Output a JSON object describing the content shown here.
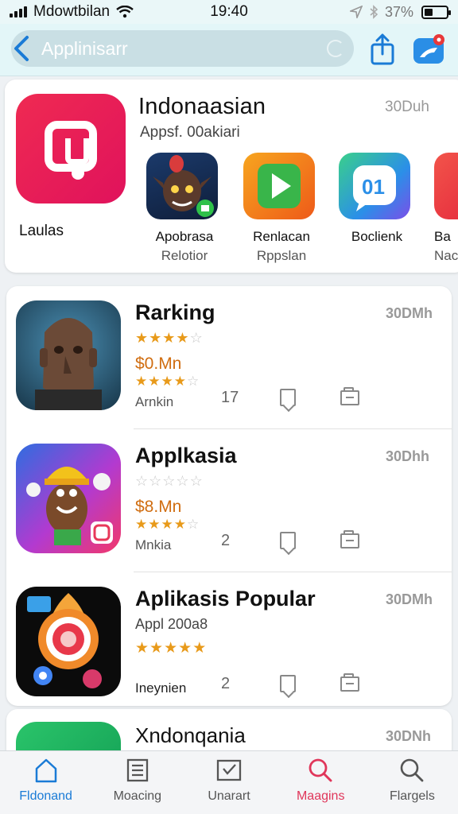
{
  "status": {
    "carrier": "Mdowtbilan",
    "time": "19:40",
    "battery": "37%",
    "battery_level": 0.37
  },
  "navbar": {
    "search_text": "Applinisarr"
  },
  "featured": {
    "title": "Indonaasian",
    "subtitle": "Appsf. 00akiari",
    "size": "30Duh",
    "label": "Laulas",
    "apps": [
      {
        "name": "Apobrasa",
        "sub": "Relotior"
      },
      {
        "name": "Renlacan",
        "sub": "Rppslan"
      },
      {
        "name": "Boclienk",
        "sub": ""
      },
      {
        "name": "Ba",
        "sub": "Nac"
      }
    ],
    "colors": {
      "main_icon": "#e81a58",
      "app2": "#f06a1a",
      "app3": "#2fa8e0"
    }
  },
  "list": [
    {
      "title": "Rarking",
      "size": "30DMh",
      "rating1": 4,
      "price": "$0.Mn",
      "rating2": 4,
      "meta": "Arnkin",
      "act1": "17"
    },
    {
      "title": "Applkasia",
      "size": "30Dhh",
      "rating1": 0,
      "price": "$8.Mn",
      "rating2": 4,
      "meta": "Mnkia",
      "act1": "2"
    },
    {
      "title": "Aplikasis Popular",
      "size": "30DMh",
      "line2": "Appl 200a8",
      "rating2": 5,
      "meta": "Ineynien",
      "act1": "2"
    }
  ],
  "peek": {
    "title": "Xndonqania",
    "size": "30DNh"
  },
  "tabs": [
    {
      "label": "Fldonand",
      "icon": "home-icon"
    },
    {
      "label": "Moacing",
      "icon": "list-icon"
    },
    {
      "label": "Unarart",
      "icon": "mail-icon"
    },
    {
      "label": "Maagins",
      "icon": "search-red-icon"
    },
    {
      "label": "Flargels",
      "icon": "search-icon"
    }
  ]
}
